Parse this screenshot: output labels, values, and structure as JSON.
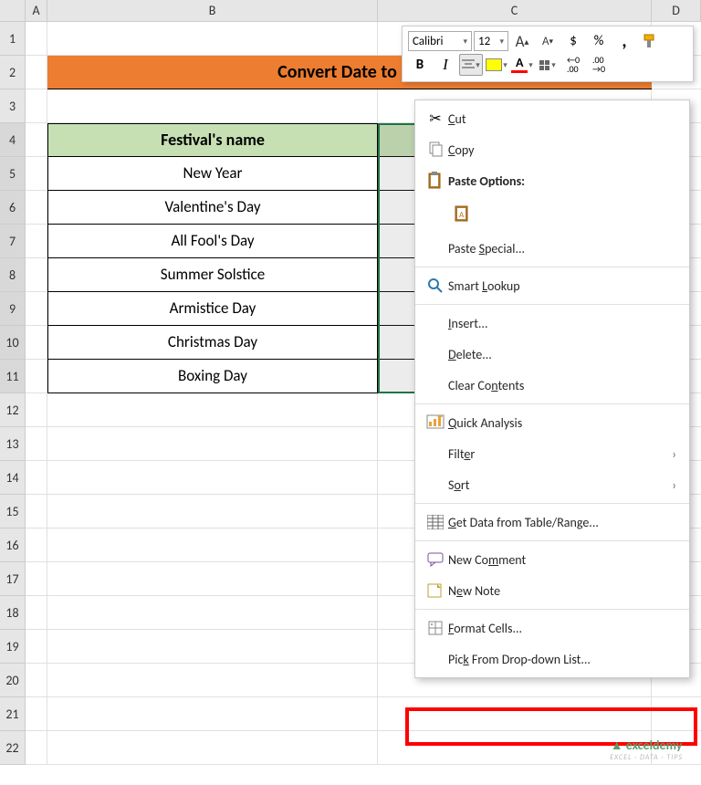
{
  "columns": {
    "a": "A",
    "b": "B",
    "c": "C",
    "d": "D"
  },
  "rows": [
    "1",
    "2",
    "3",
    "4",
    "5",
    "6",
    "7",
    "8",
    "9",
    "10",
    "11",
    "12",
    "13",
    "14",
    "15",
    "16",
    "17",
    "18",
    "19",
    "20",
    "21",
    "22"
  ],
  "title": "Convert Date to Da",
  "table_header": "Festival's name",
  "data": [
    "New Year",
    "Valentine's Day",
    "All Fool's Day",
    "Summer Solstice",
    "Armistice Day",
    "Christmas Day",
    "Boxing Day"
  ],
  "mini": {
    "font": "Calibri",
    "size": "12",
    "bold": "B",
    "italic": "I",
    "font_a": "A",
    "currency": "$",
    "percent": "%",
    "comma": ",",
    "inc_dec": ".00",
    "grow_a": "A",
    "shrink_a": "A"
  },
  "ctx": {
    "cut": "Cut",
    "copy": "Copy",
    "paste_options": "Paste Options:",
    "paste_special": "Paste Special...",
    "smart_lookup": "Smart Lookup",
    "insert": "Insert...",
    "delete": "Delete...",
    "clear": "Clear Contents",
    "quick_analysis": "Quick Analysis",
    "filter": "Filter",
    "sort": "Sort",
    "get_data": "Get Data from Table/Range...",
    "new_comment": "New Comment",
    "new_note": "New Note",
    "format_cells": "Format Cells...",
    "pick_list": "Pick From Drop-down List..."
  },
  "watermark": {
    "brand": "exceldemy",
    "tag": "EXCEL · DATA · TIPS"
  }
}
